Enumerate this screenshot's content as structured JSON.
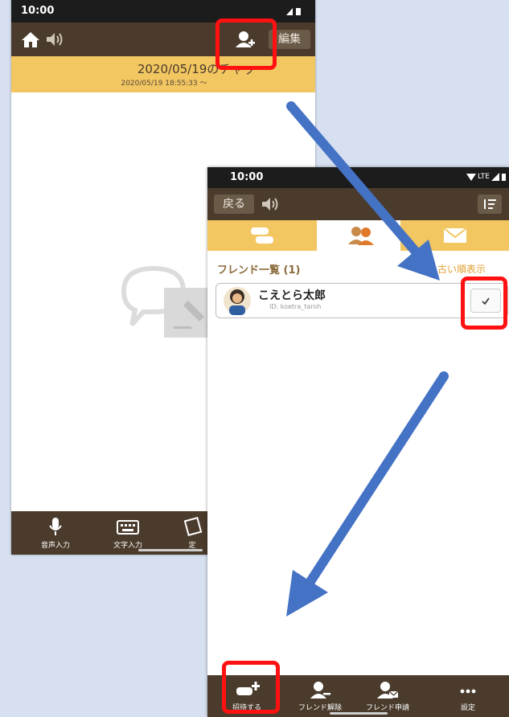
{
  "phone1": {
    "status_time": "10:00",
    "edit_button": "編集",
    "chat_title": "2020/05/19のチャッ",
    "chat_subtitle": "2020/05/19 18:55:33 〜",
    "bottom_items": [
      {
        "label": "音声入力",
        "icon": "microphone-icon"
      },
      {
        "label": "文字入力",
        "icon": "keyboard-icon"
      },
      {
        "label": "定",
        "icon": "sticker-icon"
      }
    ]
  },
  "phone2": {
    "status_time": "10:00",
    "status_network": "LTE",
    "back_button": "戻る",
    "tabs": [
      {
        "icon": "chat-icon"
      },
      {
        "icon": "friends-icon",
        "active": true
      },
      {
        "icon": "mail-icon"
      }
    ],
    "list_header": "フレンド一覧 (1)",
    "sort_label": "古い順表示",
    "friends": [
      {
        "name": "こえとら太郎",
        "id": "ID: koetra_taroh",
        "checked": true
      }
    ],
    "bottom_items": [
      {
        "label": "招待する",
        "icon": "invite-icon"
      },
      {
        "label": "フレンド解除",
        "icon": "remove-friend-icon"
      },
      {
        "label": "フレンド申請",
        "icon": "friend-request-icon"
      },
      {
        "label": "設定",
        "icon": "more-icon"
      }
    ]
  },
  "colors": {
    "header_brown": "#4a3b2c",
    "banner_yellow": "#f2c661",
    "accent_orange": "#e07a2a",
    "highlight_red": "#ff1111",
    "arrow_blue": "#4472c4",
    "background": "#d6e0f0"
  }
}
